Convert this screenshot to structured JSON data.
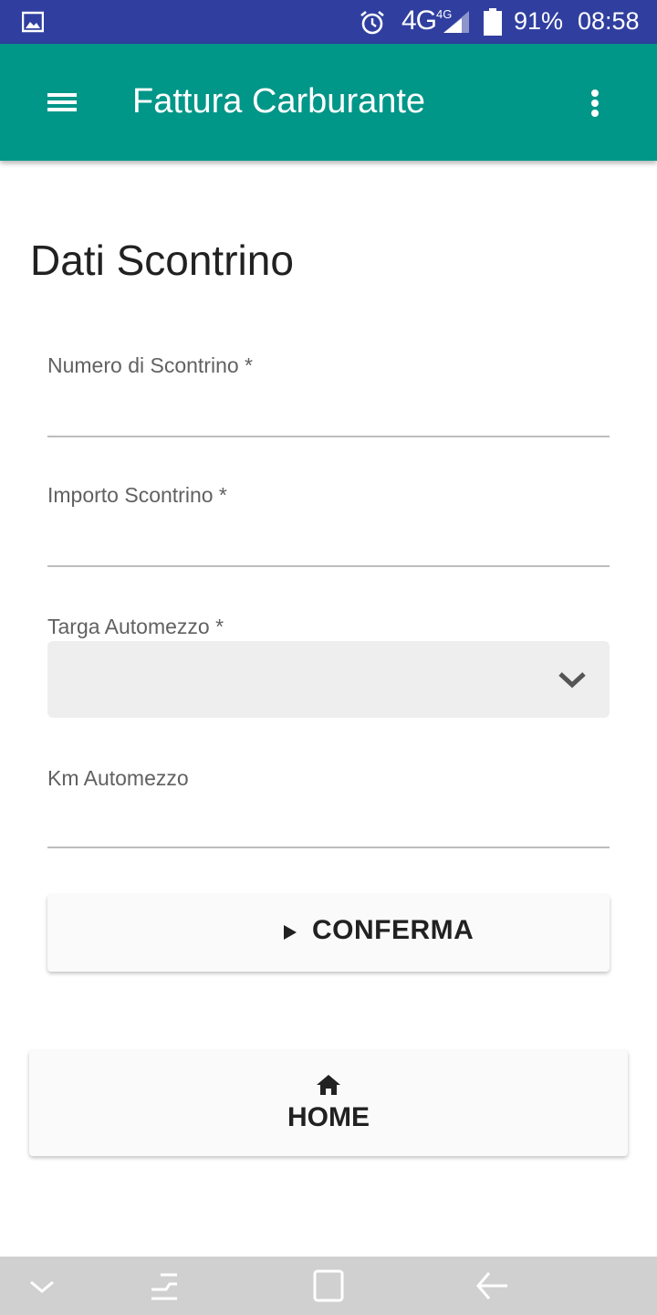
{
  "status_bar": {
    "network": "4G",
    "network_small": "4G",
    "battery": "91%",
    "time": "08:58",
    "icons": [
      "gallery-icon",
      "alarm-icon",
      "signal-icon",
      "battery-icon"
    ]
  },
  "app_bar": {
    "title": "Fattura Carburante",
    "background": "#009688",
    "icons": [
      "menu-icon",
      "more-vert-icon"
    ]
  },
  "form": {
    "title": "Dati Scontrino",
    "fields": {
      "numero_scontrino": {
        "label": "Numero di Scontrino *",
        "value": ""
      },
      "importo_scontrino": {
        "label": "Importo Scontrino *",
        "value": ""
      },
      "targa_automezzo": {
        "label": "Targa Automezzo *",
        "selected": ""
      },
      "km_automezzo": {
        "label": "Km Automezzo",
        "value": ""
      }
    },
    "confirm_label": "CONFERMA"
  },
  "home_button": {
    "label": "HOME"
  },
  "nav_bar": {
    "icons": [
      "chevron-down-icon",
      "recent-apps-icon",
      "home-square-icon",
      "back-arrow-icon"
    ]
  },
  "colors": {
    "status_bar": "#303f9f",
    "accent": "#009688",
    "nav_bar": "#d0d0d0"
  }
}
